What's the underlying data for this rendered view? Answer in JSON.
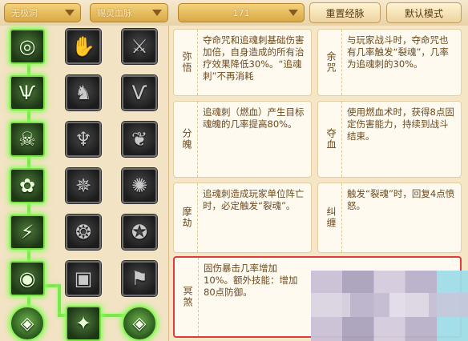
{
  "toolbar": {
    "dropdowns": [
      {
        "value": "无极洞"
      },
      {
        "value": "赐灵血脉"
      },
      {
        "value": "171"
      }
    ],
    "reset_label": "重置经脉",
    "default_label": "默认模式"
  },
  "skill_grid": {
    "icons": [
      [
        "spiral-skill-icon",
        "hand-skill-icon",
        "claw-skill-icon"
      ],
      [
        "fang-skill-icon",
        "beast-skill-icon",
        "horn-skill-icon"
      ],
      [
        "skull-skill-icon",
        "demon-skill-icon",
        "wing-skill-icon"
      ],
      [
        "flower-skill-icon",
        "ghost-skill-icon",
        "swirl-skill-icon"
      ],
      [
        "blade-skill-icon",
        "spirit-skill-icon",
        "vortex-skill-icon"
      ],
      [
        "eye-skill-icon",
        "rune-skill-icon",
        "banner-skill-icon"
      ]
    ]
  },
  "cards": [
    {
      "name": "弥悟",
      "text": "夺命咒和追魂刺基础伤害加倍，自身造成的所有治疗效果降低30%。“追魂刺”不再消耗"
    },
    {
      "name": "余咒",
      "text": "与玩家战斗时，夺命咒也有几率触发“裂魂”，几率为追魂刺的30%。"
    },
    {
      "name": "分魄",
      "text": "追魂刺（燃血）产生目标魂魄的几率提高80%。"
    },
    {
      "name": "夺血",
      "text": "使用燃血术时，获得8点固定伤害能力，持续到战斗结束。"
    },
    {
      "name": "摩劫",
      "text": "追魂刺造成玩家单位阵亡时，必定触发“裂魂”。"
    },
    {
      "name": "纠缠",
      "text": "触发“裂魂”时，回复4点愤怒。"
    },
    {
      "name": "冥煞",
      "text": "固伤暴击几率增加10%。额外技能：增加80点防御。"
    }
  ],
  "colors": {
    "accent_active": "#7be04a",
    "highlight_border": "#e23a3a",
    "dropdown_gold": "#d9a745"
  }
}
